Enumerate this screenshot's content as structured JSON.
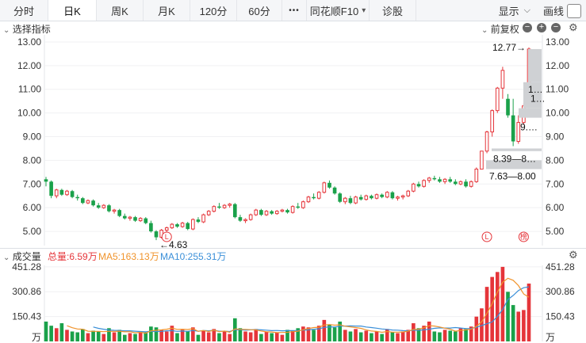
{
  "tabs": [
    {
      "label": "分时",
      "active": false
    },
    {
      "label": "日K",
      "active": true
    },
    {
      "label": "周K",
      "active": false
    },
    {
      "label": "月K",
      "active": false
    },
    {
      "label": "120分",
      "active": false
    },
    {
      "label": "60分",
      "active": false
    },
    {
      "label": "•••",
      "active": false
    },
    {
      "label": "同花顺F10",
      "active": false,
      "dropdown": true
    },
    {
      "label": "诊股",
      "active": false
    }
  ],
  "toolbar": {
    "display_label": "显示",
    "draw_label": "画线"
  },
  "price_panel": {
    "title": "选择指标",
    "adjust_label": "前复权",
    "controls": [
      "−",
      "+",
      "−"
    ],
    "y_ticks": [
      "13.00",
      "12.00",
      "11.00",
      "10.00",
      "9.00",
      "8.00",
      "7.00",
      "6.00",
      "5.00"
    ],
    "annotations": {
      "low": "←4.63",
      "high": "12.77→",
      "box1": "7.63—8.00",
      "box2": "8.39—8…",
      "box3": "9.…",
      "box4": "1…",
      "box5": "1…"
    },
    "markers": [
      "L",
      "L",
      "榜"
    ]
  },
  "volume_panel": {
    "title": "成交量",
    "total_label": "总量:6.59万",
    "ma5_label": "MA5:163.13万",
    "ma10_label": "MA10:255.31万",
    "y_ticks": [
      "451.28",
      "300.86",
      "150.43"
    ],
    "unit": "万",
    "colors": {
      "up": "#e5353a",
      "down": "#1aa14a",
      "ma5": "#f0932b",
      "ma10": "#3a8fd8"
    }
  },
  "chart_data": {
    "type": "candlestick",
    "ylim": [
      4.4,
      13.3
    ],
    "candles": [
      [
        7.2,
        7.3,
        6.9,
        7.1
      ],
      [
        7.1,
        7.15,
        6.4,
        6.5
      ],
      [
        6.5,
        6.8,
        6.4,
        6.75
      ],
      [
        6.75,
        6.8,
        6.5,
        6.55
      ],
      [
        6.55,
        6.75,
        6.5,
        6.7
      ],
      [
        6.7,
        6.75,
        6.4,
        6.45
      ],
      [
        6.45,
        6.55,
        6.3,
        6.4
      ],
      [
        6.4,
        6.45,
        6.15,
        6.2
      ],
      [
        6.2,
        6.35,
        6.15,
        6.3
      ],
      [
        6.3,
        6.35,
        6.05,
        6.1
      ],
      [
        6.1,
        6.2,
        5.95,
        6.0
      ],
      [
        6.0,
        6.15,
        5.95,
        6.1
      ],
      [
        6.1,
        6.15,
        5.8,
        5.85
      ],
      [
        5.85,
        5.95,
        5.75,
        5.9
      ],
      [
        5.9,
        5.95,
        5.6,
        5.65
      ],
      [
        5.65,
        5.75,
        5.5,
        5.55
      ],
      [
        5.55,
        5.65,
        5.45,
        5.6
      ],
      [
        5.6,
        5.65,
        5.4,
        5.45
      ],
      [
        5.45,
        5.6,
        5.4,
        5.55
      ],
      [
        5.55,
        5.6,
        5.3,
        5.35
      ],
      [
        5.35,
        5.45,
        4.95,
        5.0
      ],
      [
        5.0,
        5.05,
        4.63,
        4.75
      ],
      [
        4.75,
        5.1,
        4.7,
        5.05
      ],
      [
        5.05,
        5.2,
        4.95,
        5.15
      ],
      [
        5.15,
        5.35,
        5.1,
        5.3
      ],
      [
        5.3,
        5.35,
        5.15,
        5.2
      ],
      [
        5.2,
        5.4,
        5.15,
        5.35
      ],
      [
        5.35,
        5.4,
        5.05,
        5.1
      ],
      [
        5.1,
        5.55,
        5.05,
        5.5
      ],
      [
        5.5,
        5.6,
        5.35,
        5.4
      ],
      [
        5.4,
        5.75,
        5.35,
        5.7
      ],
      [
        5.7,
        5.9,
        5.65,
        5.85
      ],
      [
        5.85,
        6.1,
        5.8,
        6.05
      ],
      [
        6.05,
        6.2,
        5.95,
        6.0
      ],
      [
        6.0,
        6.15,
        5.95,
        6.1
      ],
      [
        6.1,
        6.2,
        6.0,
        6.15
      ],
      [
        6.15,
        6.2,
        5.55,
        5.6
      ],
      [
        5.6,
        5.7,
        5.4,
        5.45
      ],
      [
        5.45,
        5.55,
        5.35,
        5.5
      ],
      [
        5.5,
        5.75,
        5.45,
        5.7
      ],
      [
        5.7,
        5.95,
        5.65,
        5.9
      ],
      [
        5.9,
        5.95,
        5.65,
        5.7
      ],
      [
        5.7,
        5.9,
        5.65,
        5.85
      ],
      [
        5.85,
        5.9,
        5.7,
        5.75
      ],
      [
        5.75,
        5.9,
        5.7,
        5.85
      ],
      [
        5.85,
        5.95,
        5.8,
        5.9
      ],
      [
        5.9,
        5.95,
        5.75,
        5.8
      ],
      [
        5.8,
        6.1,
        5.75,
        6.05
      ],
      [
        6.05,
        6.2,
        5.95,
        6.0
      ],
      [
        6.0,
        6.3,
        5.95,
        6.25
      ],
      [
        6.25,
        6.5,
        6.2,
        6.45
      ],
      [
        6.45,
        6.6,
        6.35,
        6.4
      ],
      [
        6.4,
        6.7,
        6.35,
        6.65
      ],
      [
        6.65,
        7.1,
        6.6,
        7.05
      ],
      [
        7.05,
        7.15,
        6.8,
        6.85
      ],
      [
        6.85,
        6.9,
        6.55,
        6.6
      ],
      [
        6.6,
        6.65,
        6.2,
        6.25
      ],
      [
        6.25,
        6.45,
        6.15,
        6.4
      ],
      [
        6.4,
        6.5,
        6.15,
        6.2
      ],
      [
        6.2,
        6.5,
        6.15,
        6.45
      ],
      [
        6.45,
        6.55,
        6.3,
        6.35
      ],
      [
        6.35,
        6.55,
        6.3,
        6.5
      ],
      [
        6.5,
        6.55,
        6.35,
        6.4
      ],
      [
        6.4,
        6.6,
        6.35,
        6.55
      ],
      [
        6.55,
        6.6,
        6.4,
        6.45
      ],
      [
        6.45,
        6.7,
        6.4,
        6.65
      ],
      [
        6.65,
        6.7,
        6.35,
        6.4
      ],
      [
        6.4,
        6.5,
        6.3,
        6.45
      ],
      [
        6.45,
        6.55,
        6.35,
        6.5
      ],
      [
        6.5,
        6.75,
        6.45,
        6.7
      ],
      [
        6.7,
        7.05,
        6.65,
        7.0
      ],
      [
        7.0,
        7.1,
        6.85,
        6.9
      ],
      [
        6.9,
        7.2,
        6.85,
        7.15
      ],
      [
        7.15,
        7.3,
        7.05,
        7.25
      ],
      [
        7.25,
        7.35,
        7.15,
        7.2
      ],
      [
        7.2,
        7.3,
        7.05,
        7.1
      ],
      [
        7.1,
        7.25,
        7.0,
        7.2
      ],
      [
        7.2,
        7.3,
        7.05,
        7.1
      ],
      [
        7.1,
        7.2,
        6.95,
        7.0
      ],
      [
        7.0,
        7.15,
        6.95,
        7.1
      ],
      [
        7.1,
        7.2,
        6.85,
        6.9
      ],
      [
        6.9,
        7.15,
        6.85,
        7.1
      ],
      [
        7.1,
        7.7,
        7.05,
        7.63
      ],
      [
        7.63,
        8.4,
        7.63,
        8.39
      ],
      [
        8.39,
        9.25,
        8.3,
        9.2
      ],
      [
        9.2,
        10.15,
        9.0,
        10.1
      ],
      [
        10.1,
        11.1,
        10.0,
        11.05
      ],
      [
        11.05,
        11.95,
        10.6,
        11.8
      ],
      [
        10.6,
        10.8,
        9.8,
        9.9
      ],
      [
        9.9,
        10.6,
        8.6,
        8.8
      ],
      [
        8.8,
        9.9,
        8.7,
        9.6
      ],
      [
        9.6,
        10.4,
        9.5,
        10.3
      ],
      [
        10.3,
        12.77,
        10.2,
        12.7
      ]
    ],
    "volumes": [
      120,
      95,
      80,
      110,
      70,
      60,
      55,
      75,
      50,
      65,
      60,
      45,
      80,
      55,
      70,
      40,
      50,
      45,
      60,
      55,
      90,
      85,
      70,
      60,
      95,
      50,
      70,
      60,
      85,
      40,
      65,
      55,
      75,
      50,
      60,
      45,
      140,
      80,
      60,
      55,
      75,
      45,
      60,
      50,
      55,
      40,
      70,
      65,
      80,
      90,
      85,
      70,
      95,
      130,
      100,
      85,
      120,
      70,
      60,
      75,
      55,
      65,
      50,
      60,
      45,
      75,
      55,
      50,
      60,
      70,
      110,
      80,
      95,
      120,
      60,
      55,
      70,
      65,
      60,
      80,
      75,
      90,
      150,
      200,
      330,
      390,
      420,
      451,
      300,
      220,
      180,
      190,
      350
    ],
    "ma5": [
      null,
      null,
      null,
      null,
      95,
      83,
      75,
      74,
      62,
      61,
      61,
      59,
      61,
      61,
      62,
      58,
      59,
      52,
      55,
      50,
      64,
      67,
      70,
      74,
      80,
      73,
      74,
      72,
      77,
      61,
      66,
      60,
      68,
      59,
      63,
      55,
      75,
      73,
      73,
      71,
      70,
      63,
      58,
      57,
      53,
      54,
      55,
      59,
      62,
      71,
      78,
      84,
      86,
      99,
      102,
      98,
      100,
      92,
      88,
      84,
      79,
      70,
      63,
      61,
      55,
      60,
      56,
      56,
      57,
      62,
      73,
      74,
      83,
      95,
      93,
      87,
      80,
      74,
      62,
      66,
      70,
      74,
      91,
      119,
      169,
      228,
      298,
      358,
      382,
      370,
      338,
      287,
      267
    ],
    "ma10": [
      null,
      null,
      null,
      null,
      null,
      null,
      null,
      null,
      null,
      87,
      79,
      74,
      69,
      67,
      66,
      64,
      64,
      62,
      60,
      58,
      62,
      60,
      61,
      64,
      65,
      61,
      63,
      61,
      66,
      62,
      66,
      64,
      67,
      62,
      62,
      60,
      70,
      71,
      68,
      70,
      72,
      70,
      68,
      65,
      66,
      64,
      65,
      65,
      66,
      68,
      70,
      74,
      76,
      85,
      88,
      87,
      92,
      93,
      94,
      93,
      93,
      87,
      84,
      80,
      75,
      73,
      69,
      68,
      65,
      64,
      68,
      67,
      70,
      74,
      79,
      82,
      81,
      81,
      84,
      81,
      77,
      78,
      86,
      96,
      107,
      118,
      152,
      193,
      253,
      278,
      308,
      325,
      330
    ]
  }
}
